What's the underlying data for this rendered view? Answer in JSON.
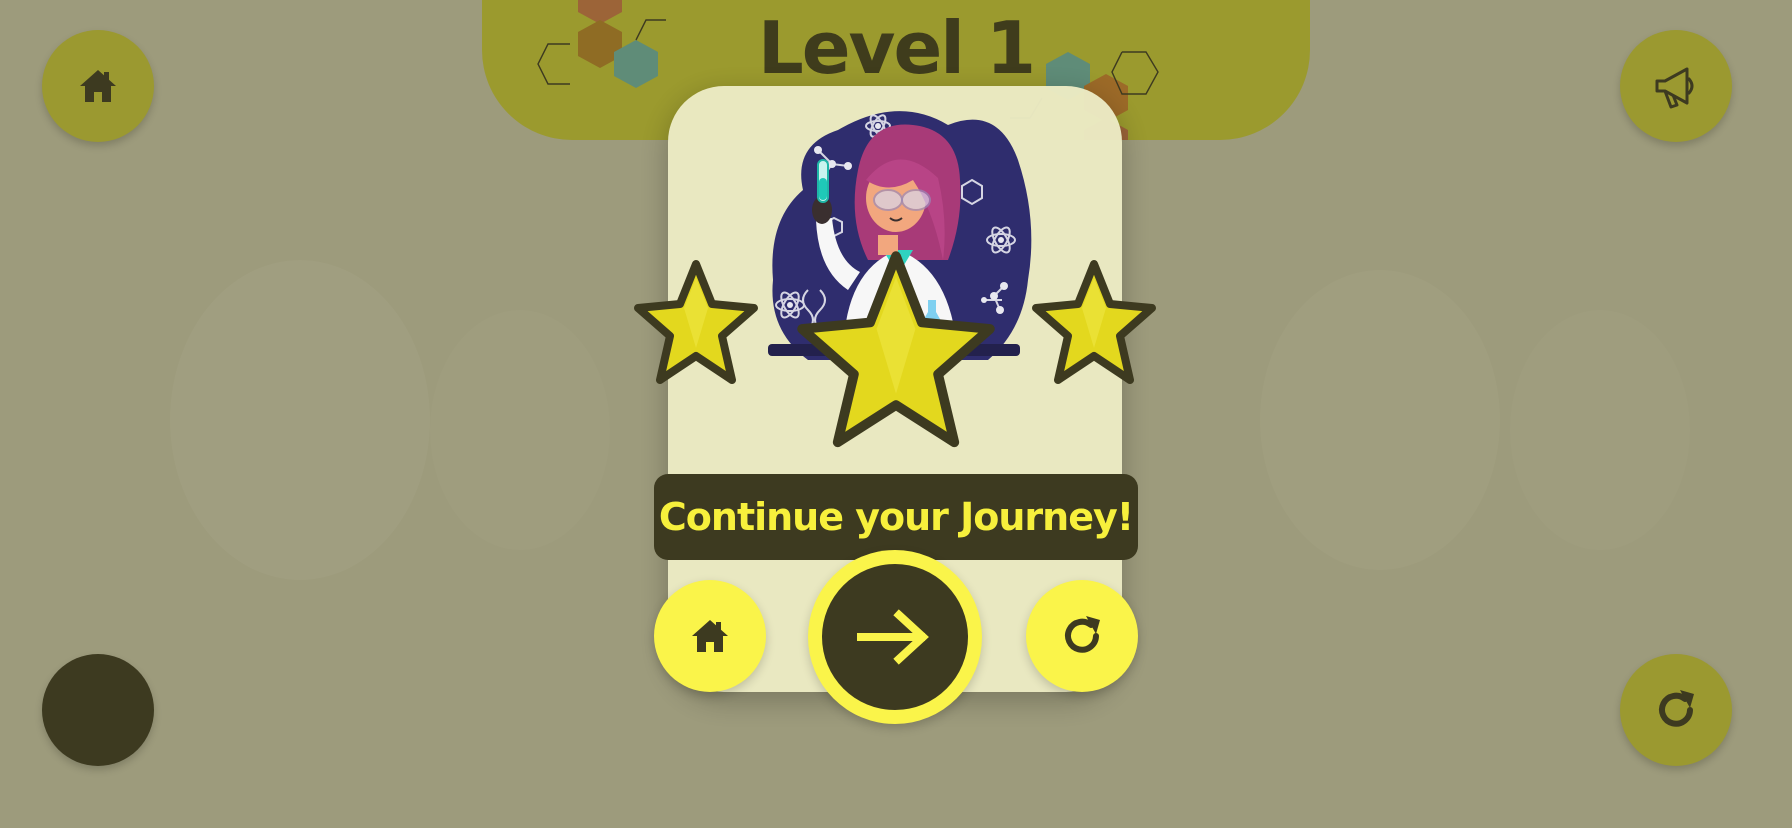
{
  "level": {
    "title": "Level 1"
  },
  "result": {
    "stars_earned": 3,
    "stars_total": 3,
    "message": "Continue your Journey!"
  },
  "corner_buttons": {
    "top_left": {
      "icon": "home-icon"
    },
    "top_right": {
      "icon": "megaphone-icon"
    },
    "bottom_left": {
      "icon": "none"
    },
    "bottom_right": {
      "icon": "restart-icon"
    }
  },
  "modal_buttons": [
    {
      "icon": "home-icon"
    },
    {
      "icon": "arrow-right-icon"
    },
    {
      "icon": "restart-icon"
    }
  ],
  "colors": {
    "background": "#9d9b7c",
    "accent_yellow": "#faf44a",
    "dark": "#3d3a20",
    "olive": "#9b9930",
    "star_fill": "#e3d81e",
    "modal_bg": "#ecebc4",
    "illustration_bg": "#2f2d6e"
  }
}
